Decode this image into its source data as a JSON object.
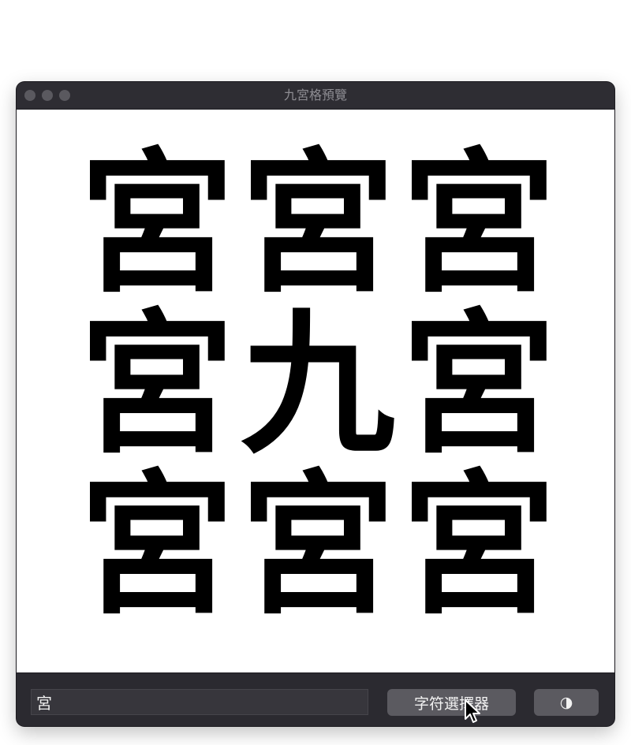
{
  "window": {
    "title": "九宮格預覽"
  },
  "grid": {
    "cells": [
      "宮",
      "宮",
      "宮",
      "宮",
      "九",
      "宮",
      "宮",
      "宮",
      "宮"
    ]
  },
  "bottom_bar": {
    "char_input_value": "宮",
    "picker_button_label": "字符選擇器",
    "contrast_button_icon": "◑"
  },
  "icons": {
    "traffic_lights": [
      "close-icon",
      "minimize-icon",
      "zoom-icon"
    ],
    "contrast": "contrast-icon",
    "cursor": "pointer-cursor-icon"
  },
  "colors": {
    "window_bg": "#2b2a30",
    "button_bg": "#5b5a60",
    "canvas_bg": "#ffffff",
    "glyph": "#000000"
  }
}
